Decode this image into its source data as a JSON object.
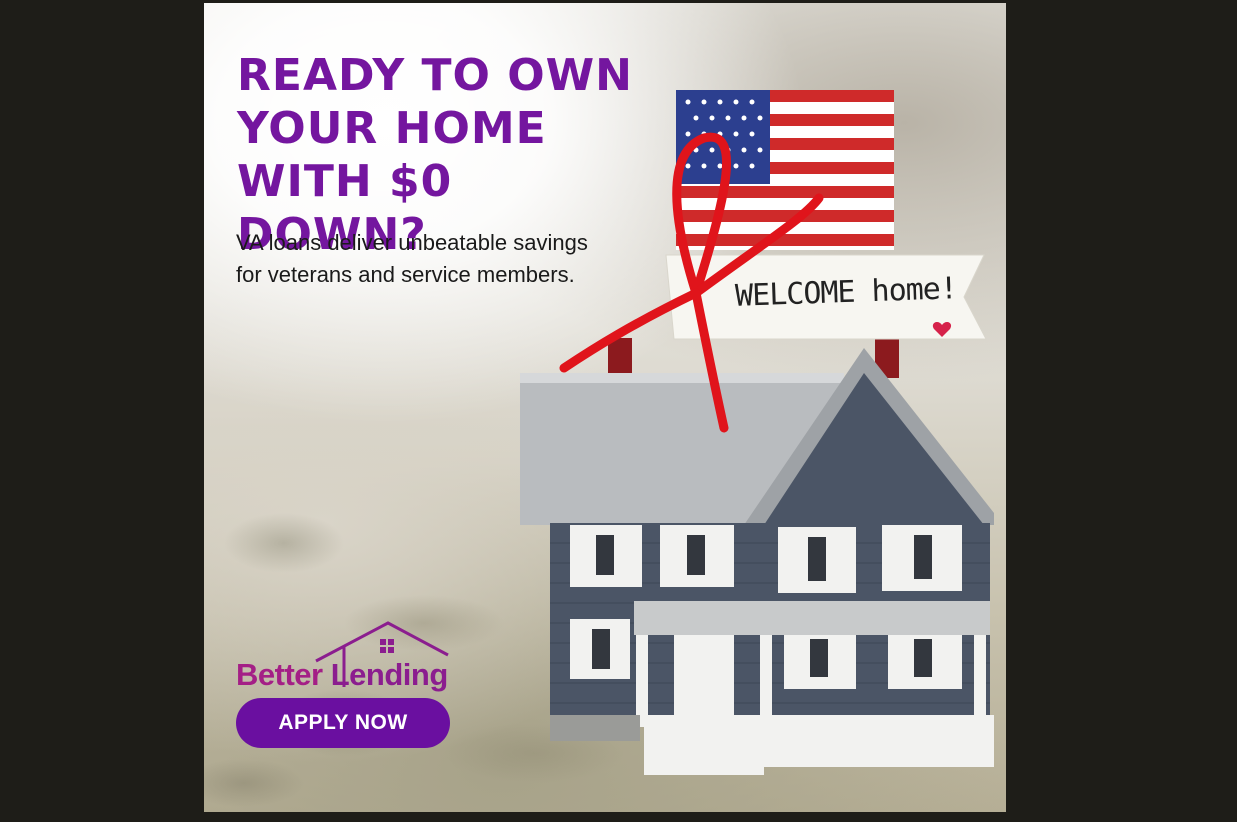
{
  "ad": {
    "headline_line1": "READY TO OWN",
    "headline_line2": "YOUR HOME",
    "headline_line3": "WITH $0 DOWN?",
    "subtext": "VA loans deliver unbeatable savings for veterans and service members.",
    "banner_text": "WELCOME home!",
    "logo_text_part1": "Better",
    "logo_text_part2": "Lending",
    "cta_label": "APPLY NOW"
  },
  "colors": {
    "headline": "#74169f",
    "cta_background": "#6a0fa0",
    "logo": "#8b1d8f",
    "ribbon": "#e0141b",
    "house_siding": "#4b5566"
  },
  "icons": [
    "house-roof-logo-icon",
    "heart-icon",
    "us-flag-icon",
    "red-ribbon-icon"
  ]
}
